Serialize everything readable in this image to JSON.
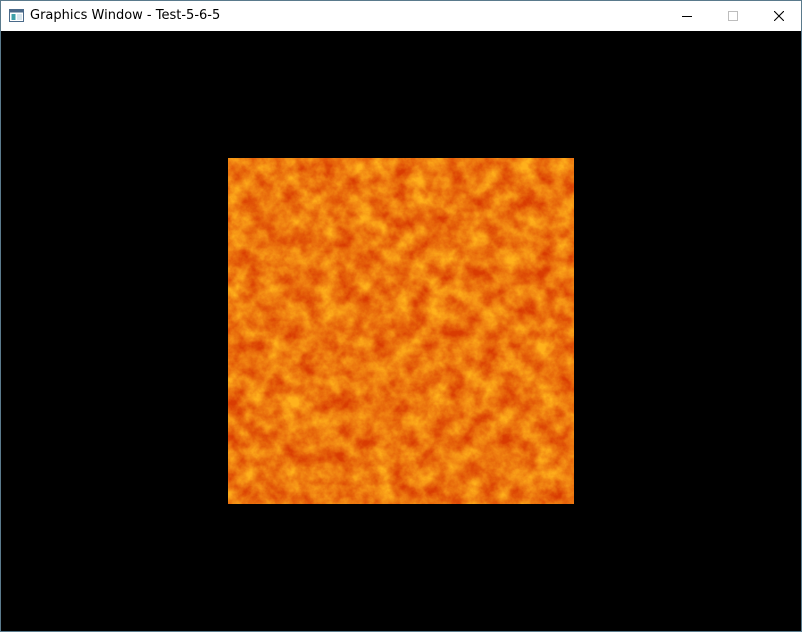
{
  "window": {
    "title": "Graphics Window - Test-5-6-5",
    "icon": "app-window-icon",
    "controls": {
      "minimize_icon": "minimize-icon",
      "maximize_icon": "maximize-icon",
      "close_icon": "close-icon"
    }
  },
  "scene": {
    "background_color": "#000000",
    "texture": {
      "description_colors": [
        "#cc2e00",
        "#e85a06",
        "#f88c0e",
        "#ffb41e"
      ]
    }
  }
}
